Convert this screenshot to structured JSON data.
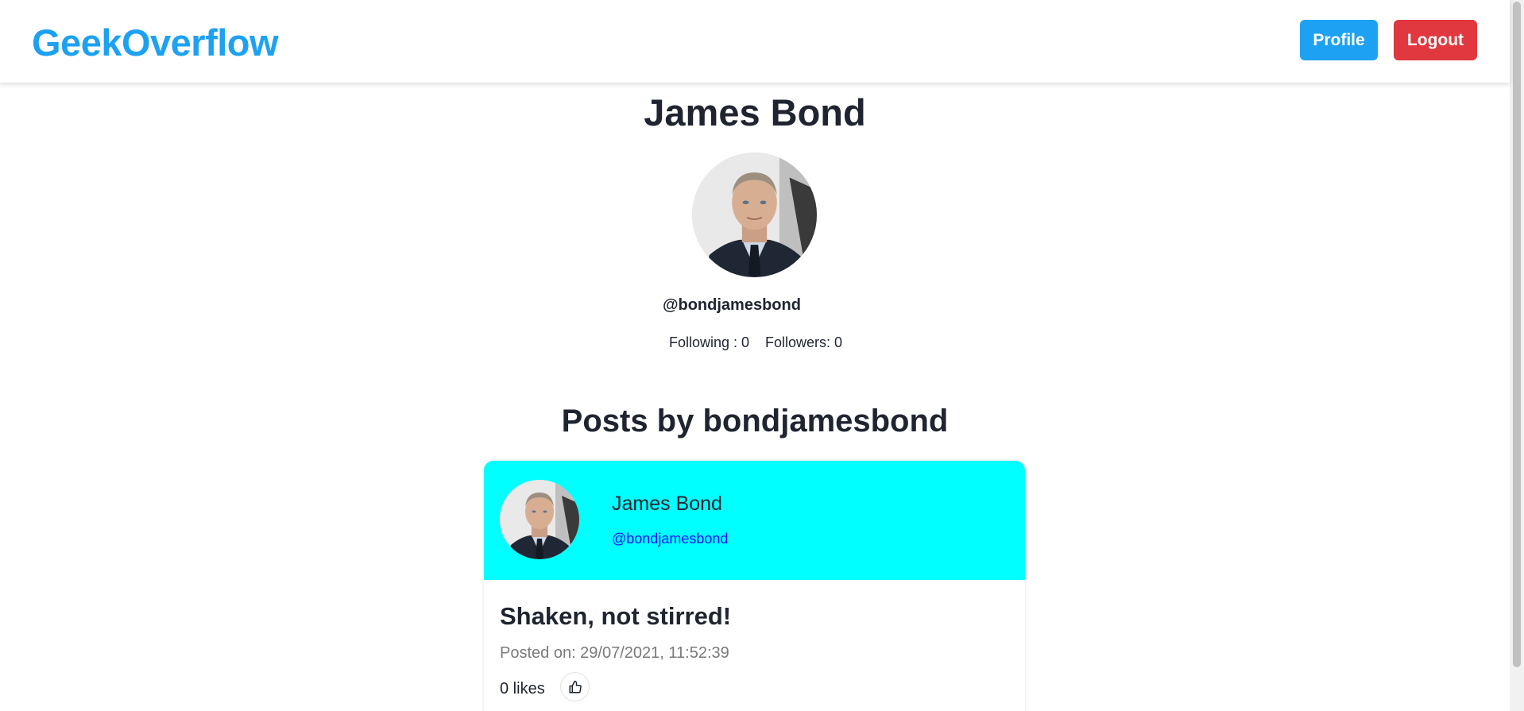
{
  "navbar": {
    "brand": "GeekOverflow",
    "profile_label": "Profile",
    "logout_label": "Logout"
  },
  "profile": {
    "name": "James Bond",
    "avatar_icon": "person-portrait-icon",
    "handle": "@bondjamesbond",
    "following_label": "Following : 0",
    "followers_label": "Followers: 0"
  },
  "posts": {
    "heading": "Posts by bondjamesbond",
    "items": [
      {
        "author": "James Bond",
        "handle": "@bondjamesbond",
        "title": "Shaken, not stirred!",
        "posted_on": "Posted on: 29/07/2021, 11:52:39",
        "likes": "0 likes",
        "like_icon": "thumbs-up-icon"
      }
    ]
  },
  "colors": {
    "brand": "#1da1f2",
    "profile_button": "#1da1f2",
    "logout_button": "#e0383e",
    "post_header": "#00ffff",
    "link": "#1a0dff"
  }
}
